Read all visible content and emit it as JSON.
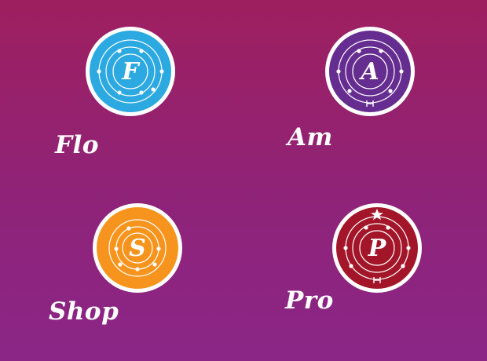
{
  "apps": [
    {
      "label": "Flo",
      "letter": "F",
      "color": "#2ca9e1",
      "icon": "orbit-badge-icon"
    },
    {
      "label": "Am",
      "letter": "A",
      "color": "#662d91",
      "icon": "orbit-badge-icon"
    },
    {
      "label": "Shop",
      "letter": "S",
      "color": "#f7941d",
      "icon": "orbit-badge-icon"
    },
    {
      "label": "Pro",
      "letter": "P",
      "color": "#a3162a",
      "icon": "orbit-badge-star-icon"
    }
  ]
}
